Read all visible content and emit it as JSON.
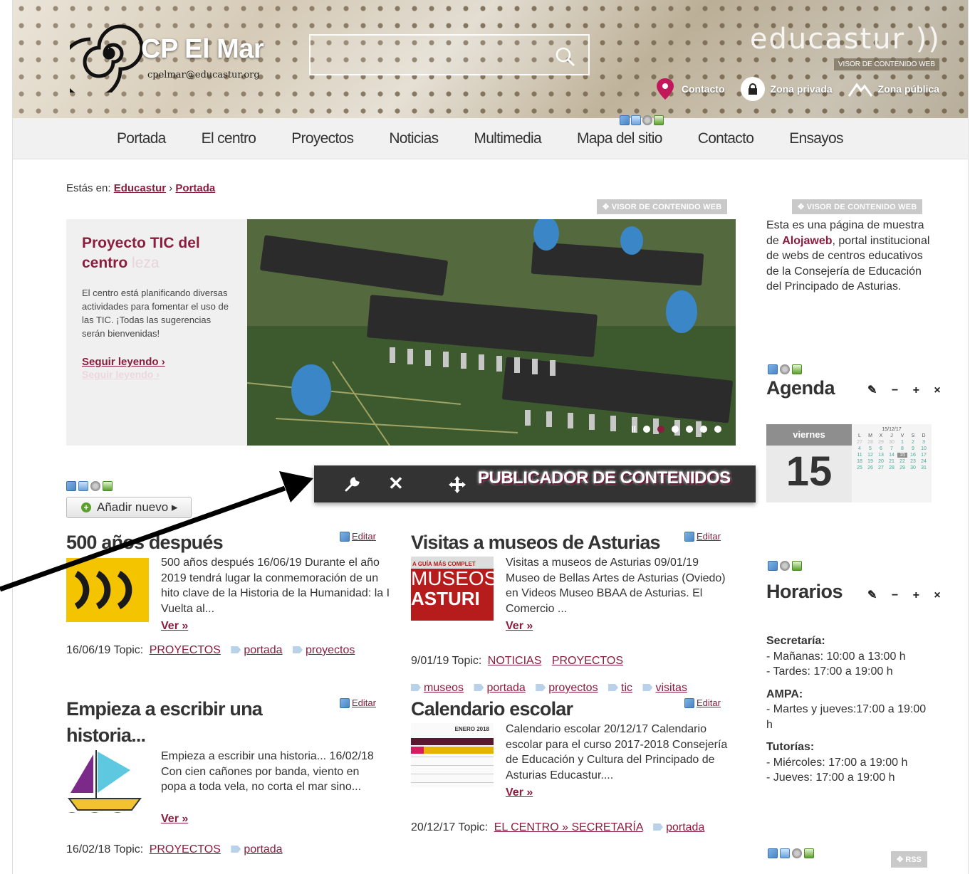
{
  "header": {
    "site_title": "CP El Mar",
    "email": "cpelmar@educastur.org",
    "brand": "educastur ))",
    "brand_badge": "VISOR DE CONTENIDO WEB",
    "links": [
      {
        "label": "Contacto",
        "icon": "map-pin-icon"
      },
      {
        "label": "Zona privada",
        "icon": "lock-icon"
      },
      {
        "label": "Zona pública",
        "icon": "mountain-icon"
      }
    ]
  },
  "nav": {
    "items": [
      "Portada",
      "El centro",
      "Proyectos",
      "Noticias",
      "Multimedia",
      "Mapa del sitio",
      "Contacto",
      "Ensayos"
    ]
  },
  "breadcrumb": {
    "prefix": "Estás en:",
    "items": [
      "Educastur",
      "Portada"
    ],
    "sep": "›"
  },
  "visor_label": "VISOR DE CONTENIDO WEB",
  "slider": {
    "title": "Proyecto TIC del centro",
    "title_ghost": "leza",
    "body": "El centro está planificando diversas actividades para fomentar el uso de las TIC. ¡Todas las sugerencias serán bienvenidas!",
    "link": "Seguir leyendo ›",
    "link_ghost": "Seguir leyendo ›",
    "pause": "II"
  },
  "intro": {
    "text_before": "Esta es una página de muestra de ",
    "bold": "Alojaweb",
    "text_after": ", portal institucional de webs de centros educativos de la Consejería de Educación del Principado de Asturias."
  },
  "agenda": {
    "title": "Agenda",
    "controls": "✎ − + ×",
    "weekday": "viernes",
    "day": "15",
    "month_label": "15/12/17",
    "weekdays": [
      "L",
      "M",
      "X",
      "J",
      "V",
      "S",
      "D"
    ],
    "days": [
      "27",
      "28",
      "29",
      "30",
      "1",
      "2",
      "3",
      "4",
      "5",
      "6",
      "7",
      "8",
      "9",
      "10",
      "11",
      "12",
      "13",
      "14",
      "15",
      "16",
      "17",
      "18",
      "19",
      "20",
      "21",
      "22",
      "23",
      "24",
      "25",
      "26",
      "27",
      "28",
      "29",
      "30",
      "31"
    ]
  },
  "horarios": {
    "title": "Horarios",
    "sections": [
      {
        "head": "Secretaría:",
        "lines": [
          "- Mañanas: 10:00 a 13:00 h",
          "- Tardes: 17:00 a 19:00 h"
        ]
      },
      {
        "head": "AMPA:",
        "lines": [
          "- Martes y jueves:17:00 a 19:00 h"
        ]
      },
      {
        "head": "Tutorías:",
        "lines": [
          "- Miércoles: 17:00 a 19:00 h",
          "- Jueves: 17:00 a 19:00 h"
        ]
      }
    ]
  },
  "publisher": {
    "label": "PUBLICADOR DE CONTENIDOS",
    "close": "✕"
  },
  "add_button": "Añadir nuevo ▸",
  "edit_label": "Editar",
  "more_label": "Ver »",
  "rss_label": "RSS",
  "articles": [
    {
      "title": "500 años después",
      "summary": "500 años después 16/06/19 Durante el año 2019 tendrá lugar la conmemoración de un hito clave de la Historia de la Humanidad: la I Vuelta al...",
      "date": "16/06/19",
      "topic_label": "Topic:",
      "topics": [
        "PROYECTOS"
      ],
      "tags": [
        "portada",
        "proyectos"
      ]
    },
    {
      "title": "Visitas a museos de Asturias",
      "summary": "Visitas a museos de Asturias 09/01/19 Museo de Bellas Artes de Asturias (Oviedo) en Videos Museo BBAA de Asturias. El Comercio ...",
      "thumb_line1": "A GUÍA MÁS COMPLET",
      "thumb_line2": "MUSEOS",
      "thumb_line3": "ASTURI",
      "date": "9/01/19",
      "topic_label": "Topic:",
      "topics": [
        "NOTICIAS",
        "PROYECTOS"
      ],
      "tags": [
        "museos",
        "portada",
        "proyectos",
        "tic",
        "visitas"
      ]
    },
    {
      "title": "Empieza a escribir una historia...",
      "summary": "Empieza a escribir una historia... 16/02/18 Con cien cañones por banda, viento en popa a toda vela, no corta el mar sino...",
      "date": "16/02/18",
      "topic_label": "Topic:",
      "topics": [
        "PROYECTOS"
      ],
      "tags": [
        "portada"
      ]
    },
    {
      "title": "Calendario escolar",
      "summary": "Calendario escolar 20/12/17 Calendario escolar para el curso 2017-2018 Consejería de Educación y Cultura del Principado de Asturias Educastur....",
      "thumb_label": "ENERO 2018",
      "date": "20/12/17",
      "topic_label": "Topic:",
      "topics": [
        "EL CENTRO » SECRETARÍA"
      ],
      "tags": [
        "portada"
      ]
    }
  ],
  "colors": {
    "accent": "#8b1e3f",
    "nav_bg": "#f1f1f1",
    "toolbar_bg": "#333333"
  }
}
